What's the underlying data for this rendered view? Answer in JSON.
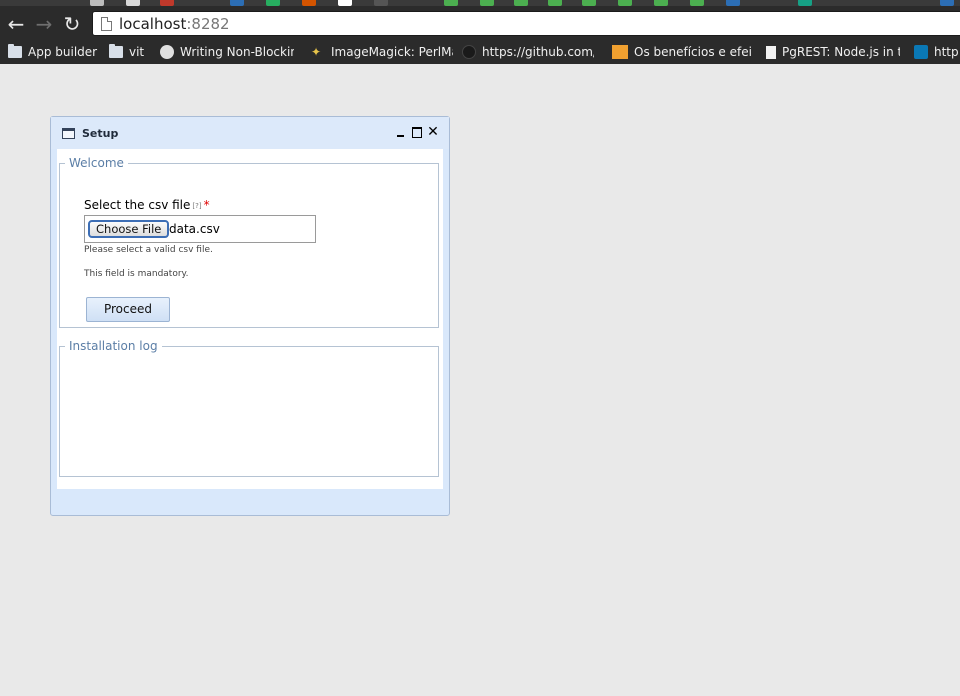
{
  "browser": {
    "url_host": "localhost",
    "url_port": ":8282",
    "bookmarks": [
      {
        "label": "App builder",
        "icon": "folder-icon"
      },
      {
        "label": "vit",
        "icon": "folder-icon"
      },
      {
        "label": "Writing Non-Blocking",
        "icon": "site-icon"
      },
      {
        "label": "ImageMagick: PerlMa",
        "icon": "wand-icon"
      },
      {
        "label": "https://github.com/in",
        "icon": "github-icon"
      },
      {
        "label": "Os benefícios e efeit",
        "icon": "site-icon"
      },
      {
        "label": "PgREST: Node.js in th",
        "icon": "page-icon"
      },
      {
        "label": "http:",
        "icon": "linkedin-icon"
      }
    ]
  },
  "window": {
    "title": "Setup",
    "close_glyph": "✕"
  },
  "welcome": {
    "legend": "Welcome",
    "field_label": "Select the csv file",
    "help_marker": "[?]",
    "required_marker": "*",
    "choose_button": "Choose File",
    "file_name": "data.csv",
    "hint_invalid": "Please select a valid csv file.",
    "hint_mandatory": "This field is mandatory.",
    "proceed_button": "Proceed"
  },
  "log": {
    "legend": "Installation log"
  },
  "colors": {
    "window_bg": "#d9e8fb",
    "legend_text": "#5b7ea6",
    "required": "#e00000",
    "page_bg": "#e9e9e9"
  }
}
